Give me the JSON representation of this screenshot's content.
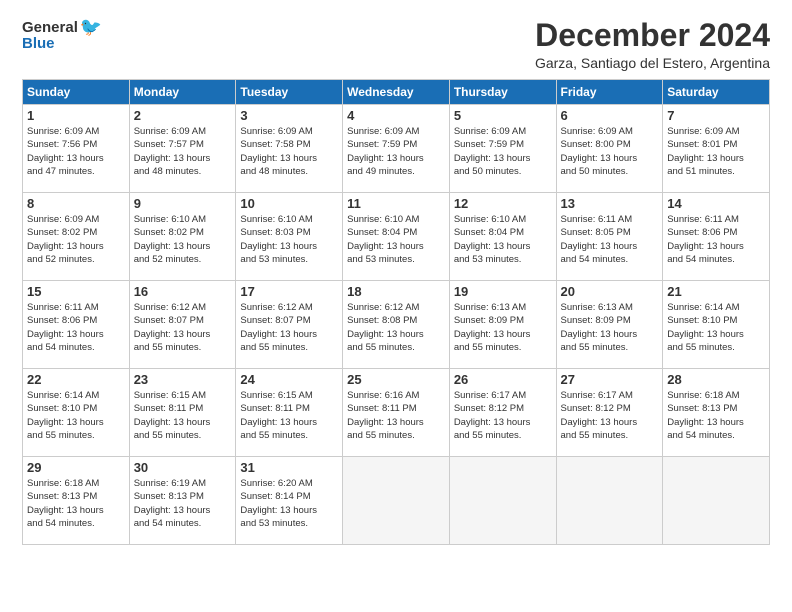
{
  "logo": {
    "line1": "General",
    "line2": "Blue"
  },
  "title": "December 2024",
  "subtitle": "Garza, Santiago del Estero, Argentina",
  "days_header": [
    "Sunday",
    "Monday",
    "Tuesday",
    "Wednesday",
    "Thursday",
    "Friday",
    "Saturday"
  ],
  "weeks": [
    [
      {
        "day": "1",
        "info": "Sunrise: 6:09 AM\nSunset: 7:56 PM\nDaylight: 13 hours\nand 47 minutes."
      },
      {
        "day": "2",
        "info": "Sunrise: 6:09 AM\nSunset: 7:57 PM\nDaylight: 13 hours\nand 48 minutes."
      },
      {
        "day": "3",
        "info": "Sunrise: 6:09 AM\nSunset: 7:58 PM\nDaylight: 13 hours\nand 48 minutes."
      },
      {
        "day": "4",
        "info": "Sunrise: 6:09 AM\nSunset: 7:59 PM\nDaylight: 13 hours\nand 49 minutes."
      },
      {
        "day": "5",
        "info": "Sunrise: 6:09 AM\nSunset: 7:59 PM\nDaylight: 13 hours\nand 50 minutes."
      },
      {
        "day": "6",
        "info": "Sunrise: 6:09 AM\nSunset: 8:00 PM\nDaylight: 13 hours\nand 50 minutes."
      },
      {
        "day": "7",
        "info": "Sunrise: 6:09 AM\nSunset: 8:01 PM\nDaylight: 13 hours\nand 51 minutes."
      }
    ],
    [
      {
        "day": "8",
        "info": "Sunrise: 6:09 AM\nSunset: 8:02 PM\nDaylight: 13 hours\nand 52 minutes."
      },
      {
        "day": "9",
        "info": "Sunrise: 6:10 AM\nSunset: 8:02 PM\nDaylight: 13 hours\nand 52 minutes."
      },
      {
        "day": "10",
        "info": "Sunrise: 6:10 AM\nSunset: 8:03 PM\nDaylight: 13 hours\nand 53 minutes."
      },
      {
        "day": "11",
        "info": "Sunrise: 6:10 AM\nSunset: 8:04 PM\nDaylight: 13 hours\nand 53 minutes."
      },
      {
        "day": "12",
        "info": "Sunrise: 6:10 AM\nSunset: 8:04 PM\nDaylight: 13 hours\nand 53 minutes."
      },
      {
        "day": "13",
        "info": "Sunrise: 6:11 AM\nSunset: 8:05 PM\nDaylight: 13 hours\nand 54 minutes."
      },
      {
        "day": "14",
        "info": "Sunrise: 6:11 AM\nSunset: 8:06 PM\nDaylight: 13 hours\nand 54 minutes."
      }
    ],
    [
      {
        "day": "15",
        "info": "Sunrise: 6:11 AM\nSunset: 8:06 PM\nDaylight: 13 hours\nand 54 minutes."
      },
      {
        "day": "16",
        "info": "Sunrise: 6:12 AM\nSunset: 8:07 PM\nDaylight: 13 hours\nand 55 minutes."
      },
      {
        "day": "17",
        "info": "Sunrise: 6:12 AM\nSunset: 8:07 PM\nDaylight: 13 hours\nand 55 minutes."
      },
      {
        "day": "18",
        "info": "Sunrise: 6:12 AM\nSunset: 8:08 PM\nDaylight: 13 hours\nand 55 minutes."
      },
      {
        "day": "19",
        "info": "Sunrise: 6:13 AM\nSunset: 8:09 PM\nDaylight: 13 hours\nand 55 minutes."
      },
      {
        "day": "20",
        "info": "Sunrise: 6:13 AM\nSunset: 8:09 PM\nDaylight: 13 hours\nand 55 minutes."
      },
      {
        "day": "21",
        "info": "Sunrise: 6:14 AM\nSunset: 8:10 PM\nDaylight: 13 hours\nand 55 minutes."
      }
    ],
    [
      {
        "day": "22",
        "info": "Sunrise: 6:14 AM\nSunset: 8:10 PM\nDaylight: 13 hours\nand 55 minutes."
      },
      {
        "day": "23",
        "info": "Sunrise: 6:15 AM\nSunset: 8:11 PM\nDaylight: 13 hours\nand 55 minutes."
      },
      {
        "day": "24",
        "info": "Sunrise: 6:15 AM\nSunset: 8:11 PM\nDaylight: 13 hours\nand 55 minutes."
      },
      {
        "day": "25",
        "info": "Sunrise: 6:16 AM\nSunset: 8:11 PM\nDaylight: 13 hours\nand 55 minutes."
      },
      {
        "day": "26",
        "info": "Sunrise: 6:17 AM\nSunset: 8:12 PM\nDaylight: 13 hours\nand 55 minutes."
      },
      {
        "day": "27",
        "info": "Sunrise: 6:17 AM\nSunset: 8:12 PM\nDaylight: 13 hours\nand 55 minutes."
      },
      {
        "day": "28",
        "info": "Sunrise: 6:18 AM\nSunset: 8:13 PM\nDaylight: 13 hours\nand 54 minutes."
      }
    ],
    [
      {
        "day": "29",
        "info": "Sunrise: 6:18 AM\nSunset: 8:13 PM\nDaylight: 13 hours\nand 54 minutes."
      },
      {
        "day": "30",
        "info": "Sunrise: 6:19 AM\nSunset: 8:13 PM\nDaylight: 13 hours\nand 54 minutes."
      },
      {
        "day": "31",
        "info": "Sunrise: 6:20 AM\nSunset: 8:14 PM\nDaylight: 13 hours\nand 53 minutes."
      },
      null,
      null,
      null,
      null
    ]
  ]
}
